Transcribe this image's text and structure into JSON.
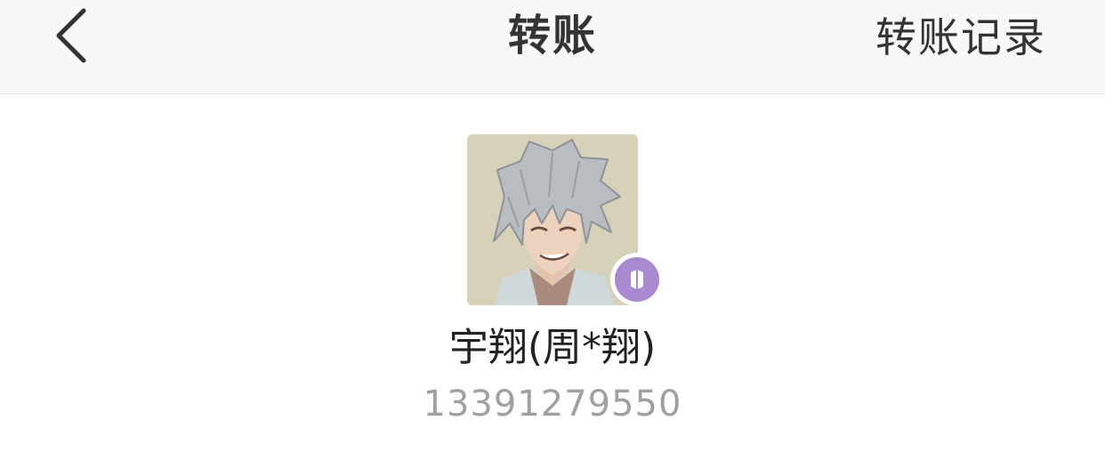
{
  "header": {
    "title": "转账",
    "action_label": "转账记录",
    "back_icon": "chevron-left-icon"
  },
  "recipient": {
    "name": "宇翔(周*翔)",
    "phone": "13391279550",
    "avatar_description": "anime-character-avatar",
    "badge_icon": "verified-badge-icon",
    "badge_color": "#a98ad0"
  },
  "colors": {
    "navbar_bg": "#f8f8f8",
    "text_primary": "#333333",
    "text_secondary": "#a0a0a0"
  }
}
